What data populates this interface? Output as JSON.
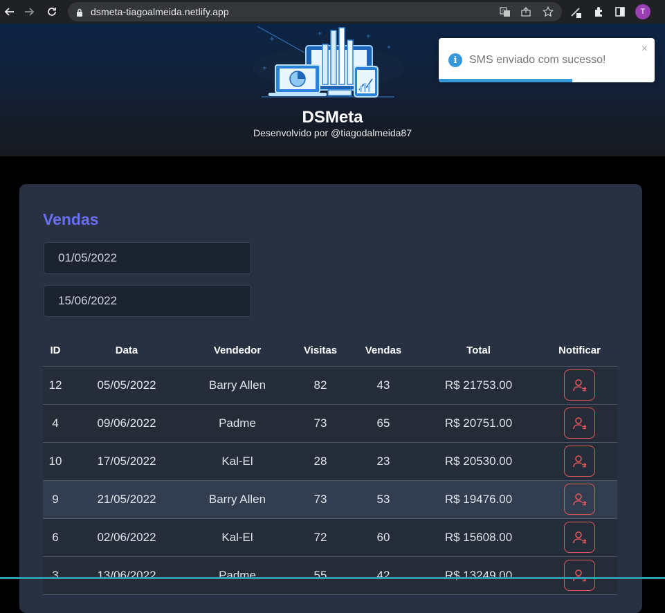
{
  "browser": {
    "url": "dsmeta-tiagoalmeida.netlify.app",
    "avatar_letter": "T"
  },
  "header": {
    "brand": "DSMeta",
    "byline": "Desenvolvido por @tiagodalmeida87"
  },
  "toast": {
    "message": "SMS enviado com sucesso!",
    "close": "×",
    "progress": 0.62
  },
  "sales": {
    "title": "Vendas",
    "min_date": "01/05/2022",
    "max_date": "15/06/2022",
    "columns": [
      "ID",
      "Data",
      "Vendedor",
      "Visitas",
      "Vendas",
      "Total",
      "Notificar"
    ],
    "rows": [
      {
        "id": "12",
        "date": "05/05/2022",
        "seller": "Barry Allen",
        "visits": "82",
        "deals": "43",
        "total": "R$ 21753.00"
      },
      {
        "id": "4",
        "date": "09/06/2022",
        "seller": "Padme",
        "visits": "73",
        "deals": "65",
        "total": "R$ 20751.00"
      },
      {
        "id": "10",
        "date": "17/05/2022",
        "seller": "Kal-El",
        "visits": "28",
        "deals": "23",
        "total": "R$ 20530.00"
      },
      {
        "id": "9",
        "date": "21/05/2022",
        "seller": "Barry Allen",
        "visits": "73",
        "deals": "53",
        "total": "R$ 19476.00"
      },
      {
        "id": "6",
        "date": "02/06/2022",
        "seller": "Kal-El",
        "visits": "72",
        "deals": "60",
        "total": "R$ 15608.00"
      },
      {
        "id": "3",
        "date": "13/06/2022",
        "seller": "Padme",
        "visits": "55",
        "deals": "42",
        "total": "R$ 13249.00"
      }
    ]
  },
  "colors": {
    "accent": "#6a6ef6",
    "notify": "#e4585a",
    "toast_info": "#3498db"
  }
}
